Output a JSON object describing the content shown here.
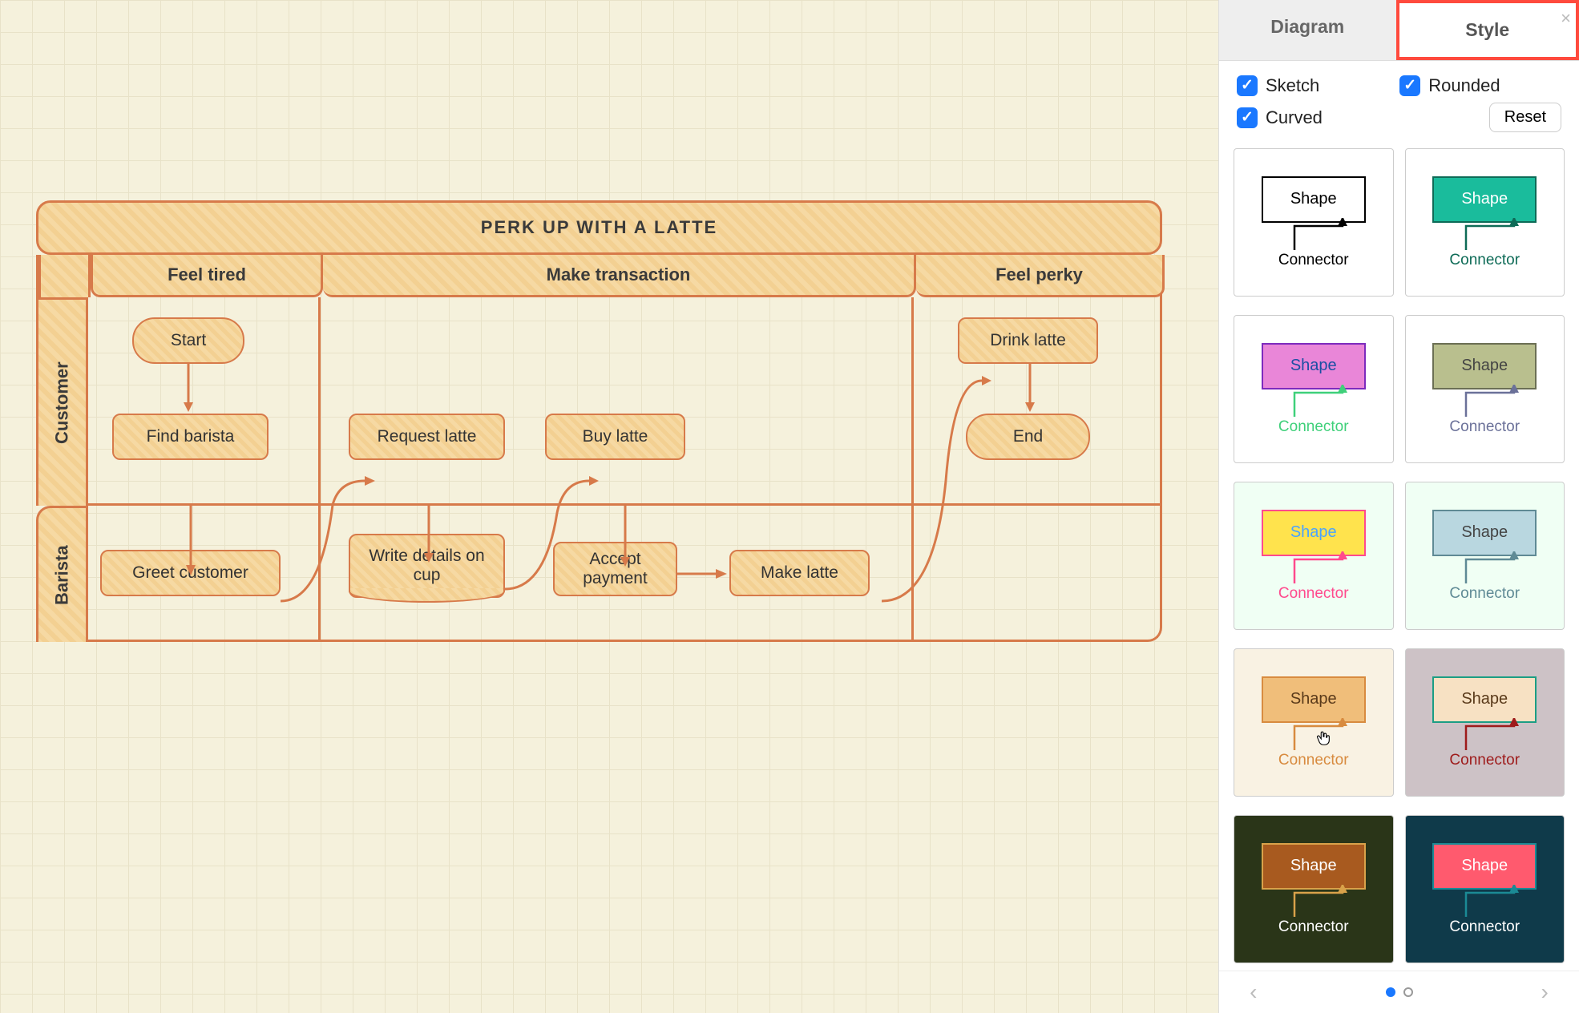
{
  "canvas": {
    "title": "PERK UP WITH A LATTE",
    "columns": [
      "Feel tired",
      "Make transaction",
      "Feel perky"
    ],
    "lanes": [
      "Customer",
      "Barista"
    ],
    "nodes": {
      "start": "Start",
      "find_barista": "Find barista",
      "greet_customer": "Greet customer",
      "request_latte": "Request latte",
      "write_details": "Write details on cup",
      "buy_latte": "Buy latte",
      "accept_payment": "Accept payment",
      "make_latte": "Make latte",
      "drink_latte": "Drink latte",
      "end": "End"
    }
  },
  "sidebar": {
    "tabs": {
      "diagram": "Diagram",
      "style": "Style"
    },
    "options": {
      "sketch": "Sketch",
      "rounded": "Rounded",
      "curved": "Curved",
      "reset": "Reset"
    },
    "swatch_shape_label": "Shape",
    "swatch_connector_label": "Connector",
    "swatches": [
      {
        "bg": "#ffffff",
        "shape_fill": "#ffffff",
        "shape_border": "#000000",
        "shape_text": "#000000",
        "conn": "#000000"
      },
      {
        "bg": "#ffffff",
        "shape_fill": "#1abc9c",
        "shape_border": "#0e6b57",
        "shape_text": "#ffffff",
        "conn": "#0e6b57"
      },
      {
        "bg": "#ffffff",
        "shape_fill": "#e986d8",
        "shape_border": "#7d2bbd",
        "shape_text": "#1a4fa3",
        "conn": "#3fd07a"
      },
      {
        "bg": "#ffffff",
        "shape_fill": "#b9bf8e",
        "shape_border": "#6b6f54",
        "shape_text": "#444444",
        "conn": "#6b7199"
      },
      {
        "bg": "#f0fff4",
        "shape_fill": "#ffe34d",
        "shape_border": "#ff4a8d",
        "shape_text": "#4aa3ff",
        "conn": "#ff4a8d"
      },
      {
        "bg": "#f0fff4",
        "shape_fill": "#b9d7e0",
        "shape_border": "#5f8a95",
        "shape_text": "#444444",
        "conn": "#5f8a95"
      },
      {
        "bg": "#f9f2e3",
        "shape_fill": "#f0be7a",
        "shape_border": "#d88b3f",
        "shape_text": "#5a3a1a",
        "conn": "#d88b3f"
      },
      {
        "bg": "#cdc2c6",
        "shape_fill": "#f7e1c3",
        "shape_border": "#1b9e84",
        "shape_text": "#5a3a1a",
        "conn": "#9e1b1b"
      },
      {
        "bg": "#2a3518",
        "shape_fill": "#a85a1f",
        "shape_border": "#d9a24a",
        "shape_text": "#ffffff",
        "conn": "#d9a24a"
      },
      {
        "bg": "#0f3a4a",
        "shape_fill": "#ff5a6e",
        "shape_border": "#1b8a95",
        "shape_text": "#ffffff",
        "conn": "#1b8a95"
      }
    ]
  }
}
